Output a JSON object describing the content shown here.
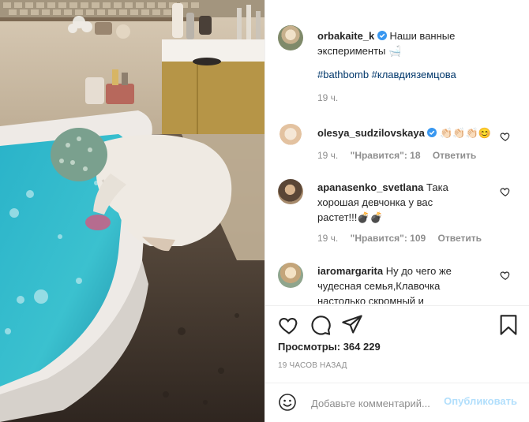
{
  "post": {
    "author": "orbakaite_k",
    "caption": "Наши ванные эксперименты 🛁",
    "hashtags": "#bathbomb #клавдияземцова",
    "time": "19 ч."
  },
  "comments": [
    {
      "user": "olesya_sudzilovskaya",
      "text": "👏🏻👏🏻👏🏻😊",
      "time": "19 ч.",
      "likes": "\"Нравится\": 18",
      "reply": "Ответить"
    },
    {
      "user": "apanasenko_svetlana",
      "text_lines": [
        "Така",
        "хорошая девчонка у вас",
        "растет!!!💣💣"
      ],
      "time": "19 ч.",
      "likes": "\"Нравится\": 109",
      "reply": "Ответить"
    },
    {
      "user": "iaromargarita",
      "text_lines": [
        "Ну до чего же",
        "чудесная семья,Клавочка",
        "настолько скромный и"
      ]
    }
  ],
  "stats": {
    "views": "Просмотры: 364 229",
    "date": "19 ЧАСОВ НАЗАД"
  },
  "comment_box": {
    "placeholder": "Добавьте комментарий...",
    "publish": "Опубликовать"
  },
  "icons": {
    "like": "heart-icon",
    "comment": "comment-icon",
    "share": "paper-plane-icon",
    "save": "bookmark-icon",
    "emoji": "smiley-icon",
    "verified": "verified-badge-icon"
  },
  "colors": {
    "link": "#00376b",
    "verified": "#3897f0",
    "publish_disabled": "#b2dffc",
    "muted": "#8e8e8e"
  }
}
